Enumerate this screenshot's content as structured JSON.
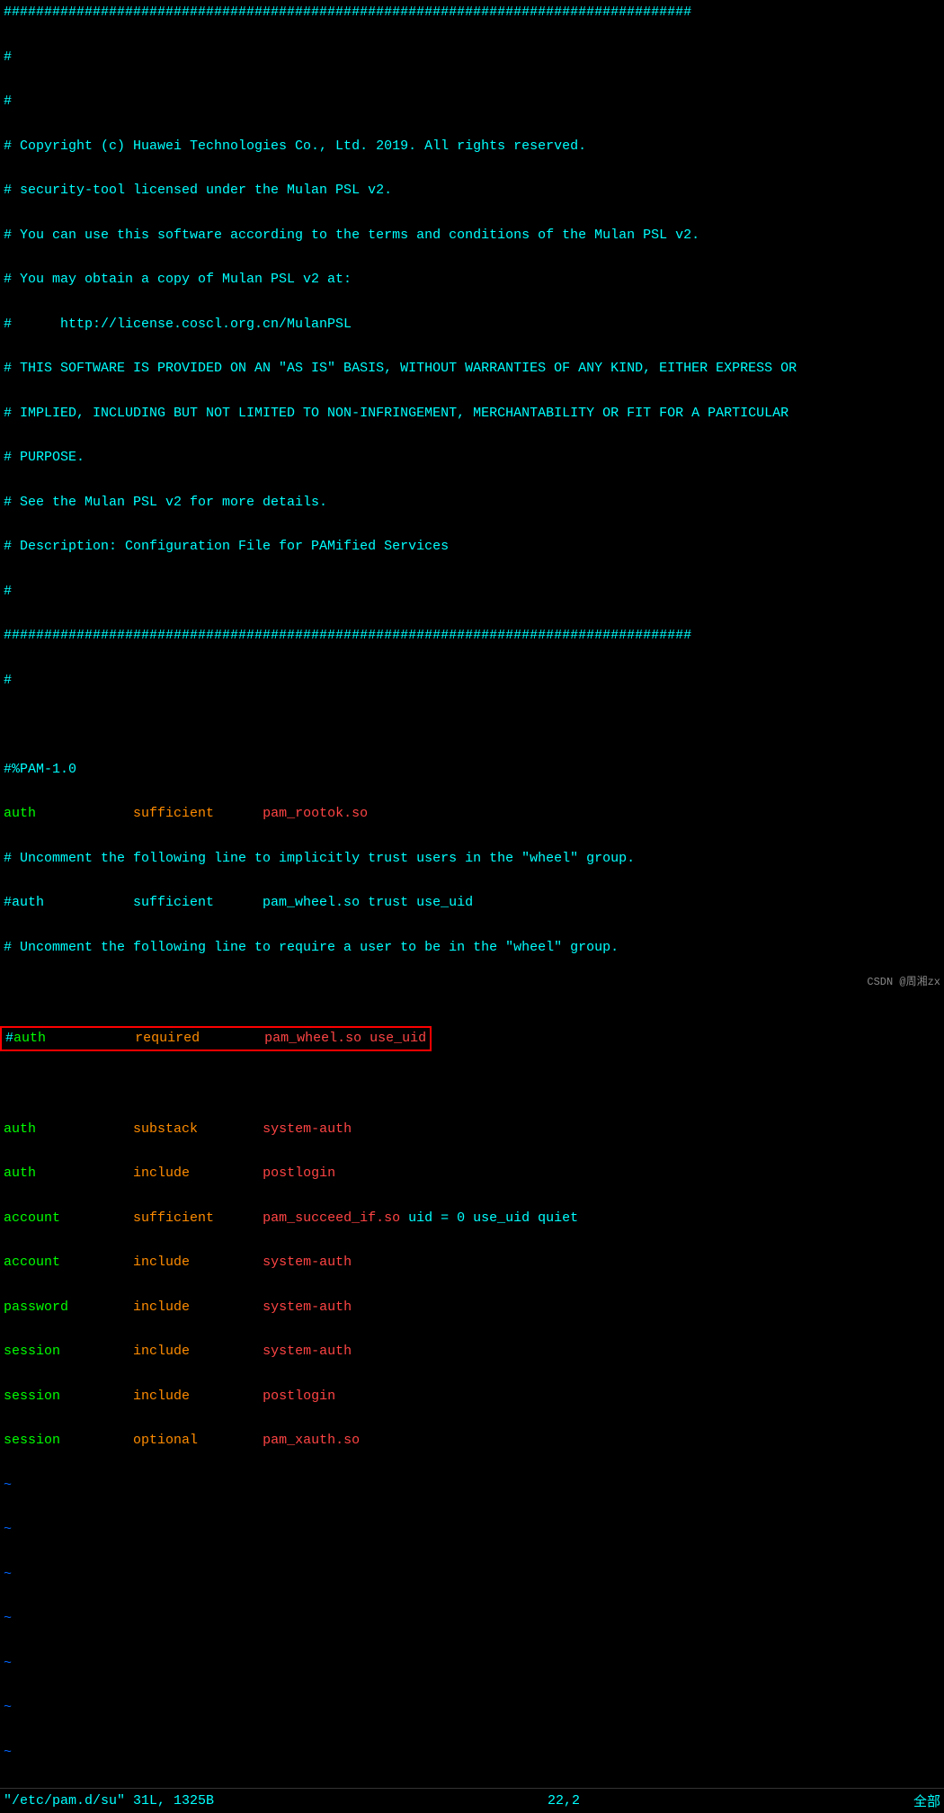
{
  "editor": {
    "lines": [
      {
        "type": "comment",
        "text": "#####################################################################################"
      },
      {
        "type": "comment",
        "text": "#"
      },
      {
        "type": "comment",
        "text": "#"
      },
      {
        "type": "comment",
        "text": "# Copyright (c) Huawei Technologies Co., Ltd. 2019. All rights reserved."
      },
      {
        "type": "comment",
        "text": "# security-tool licensed under the Mulan PSL v2."
      },
      {
        "type": "comment",
        "text": "# You can use this software according to the terms and conditions of the Mulan PSL v2."
      },
      {
        "type": "comment",
        "text": "# You may obtain a copy of Mulan PSL v2 at:"
      },
      {
        "type": "comment",
        "text": "#      http://license.coscl.org.cn/MulanPSL"
      },
      {
        "type": "comment",
        "text": "# THIS SOFTWARE IS PROVIDED ON AN \"AS IS\" BASIS, WITHOUT WARRANTIES OF ANY KIND, EITHER EXPRESS OR"
      },
      {
        "type": "comment",
        "text": "# IMPLIED, INCLUDING BUT NOT LIMITED TO NON-INFRINGEMENT, MERCHANTABILITY OR FIT FOR A PARTICULAR"
      },
      {
        "type": "comment",
        "text": "# PURPOSE."
      },
      {
        "type": "comment",
        "text": "# See the Mulan PSL v2 for more details."
      },
      {
        "type": "comment",
        "text": "# Description: Configuration File for PAMified Services"
      },
      {
        "type": "comment",
        "text": "#"
      },
      {
        "type": "comment",
        "text": "#####################################################################################"
      },
      {
        "type": "comment",
        "text": "#"
      },
      {
        "type": "empty",
        "text": ""
      },
      {
        "type": "comment",
        "text": "#%PAM-1.0"
      },
      {
        "type": "pam",
        "keyword": "auth",
        "control": "sufficient",
        "module": "pam_rootok.so",
        "args": ""
      },
      {
        "type": "comment",
        "text": "# Uncomment the following line to implicitly trust users in the \"wheel\" group."
      },
      {
        "type": "comment",
        "text": "#auth           sufficient      pam_wheel.so trust use_uid"
      },
      {
        "type": "comment",
        "text": "# Uncomment the following line to require a user to be in the \"wheel\" group."
      },
      {
        "type": "empty",
        "text": ""
      },
      {
        "type": "highlighted",
        "text": "#auth           required        pam_wheel.so use_uid"
      },
      {
        "type": "empty",
        "text": ""
      },
      {
        "type": "pam",
        "keyword": "auth",
        "control": "substack",
        "module": "system-auth",
        "args": ""
      },
      {
        "type": "pam",
        "keyword": "auth",
        "control": "include",
        "module": "postlogin",
        "args": ""
      },
      {
        "type": "pam",
        "keyword": "account",
        "control": "sufficient",
        "module": "pam_succeed_if.so",
        "args": "uid = 0 use_uid quiet"
      },
      {
        "type": "pam",
        "keyword": "account",
        "control": "include",
        "module": "system-auth",
        "args": ""
      },
      {
        "type": "pam",
        "keyword": "password",
        "control": "include",
        "module": "system-auth",
        "args": ""
      },
      {
        "type": "pam",
        "keyword": "session",
        "control": "include",
        "module": "system-auth",
        "args": ""
      },
      {
        "type": "pam",
        "keyword": "session",
        "control": "include",
        "module": "postlogin",
        "args": ""
      },
      {
        "type": "pam",
        "keyword": "session",
        "control": "optional",
        "module": "pam_xauth.so",
        "args": ""
      },
      {
        "type": "tilde",
        "text": "~"
      },
      {
        "type": "tilde",
        "text": "~"
      },
      {
        "type": "tilde",
        "text": "~"
      },
      {
        "type": "tilde",
        "text": "~"
      },
      {
        "type": "tilde",
        "text": "~"
      },
      {
        "type": "tilde",
        "text": "~"
      },
      {
        "type": "tilde",
        "text": "~"
      }
    ]
  },
  "statusbar": {
    "filename": "\"/etc/pam.d/su\"",
    "fileinfo": "31L, 1325B",
    "position": "22,2",
    "scrollpos": "全部"
  },
  "watermark": {
    "text": "CSDN @周湘zx"
  }
}
